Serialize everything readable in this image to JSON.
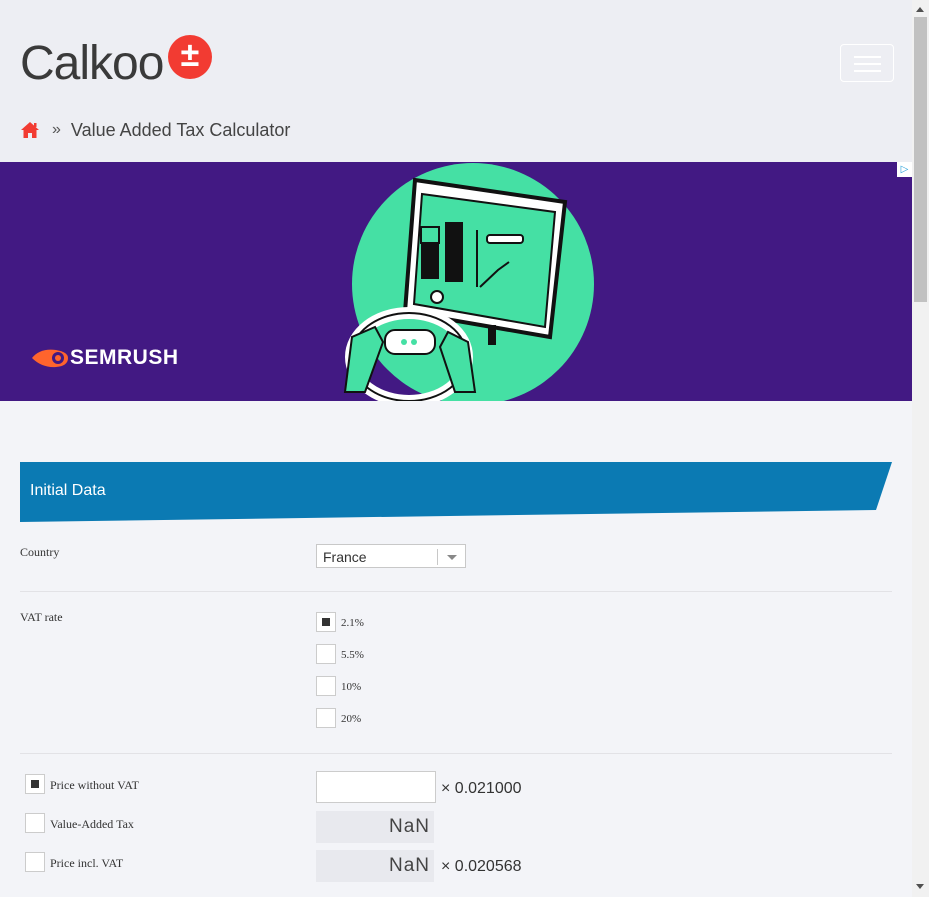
{
  "header": {
    "logo_text": "Calkoo",
    "logo_badge": "±",
    "breadcrumb_sep": "»",
    "breadcrumb_title": "Value Added Tax Calculator"
  },
  "ad": {
    "brand": "SEMRUSH",
    "close_glyph": "▷"
  },
  "section": {
    "title": "Initial Data"
  },
  "form": {
    "country_label": "Country",
    "country_value": "France",
    "vat_rate_label": "VAT rate",
    "vat_rates": [
      "2.1%",
      "5.5%",
      "10%",
      "20%"
    ],
    "selected_rate": "2.1%",
    "price_without_vat_label": "Price without VAT",
    "vat_label": "Value-Added Tax",
    "price_incl_vat_label": "Price incl. VAT",
    "price_without_vat_value": "",
    "vat_value": "NaN",
    "price_incl_vat_value": "NaN",
    "factor_without_vat": "× 0.021000",
    "factor_incl_vat": "× 0.020568",
    "selected_mode": "Price without VAT"
  },
  "colors": {
    "accent": "#0b7ab3",
    "brand_red": "#f23b32",
    "ad_background": "#421983",
    "ad_green": "#45e0a4"
  }
}
